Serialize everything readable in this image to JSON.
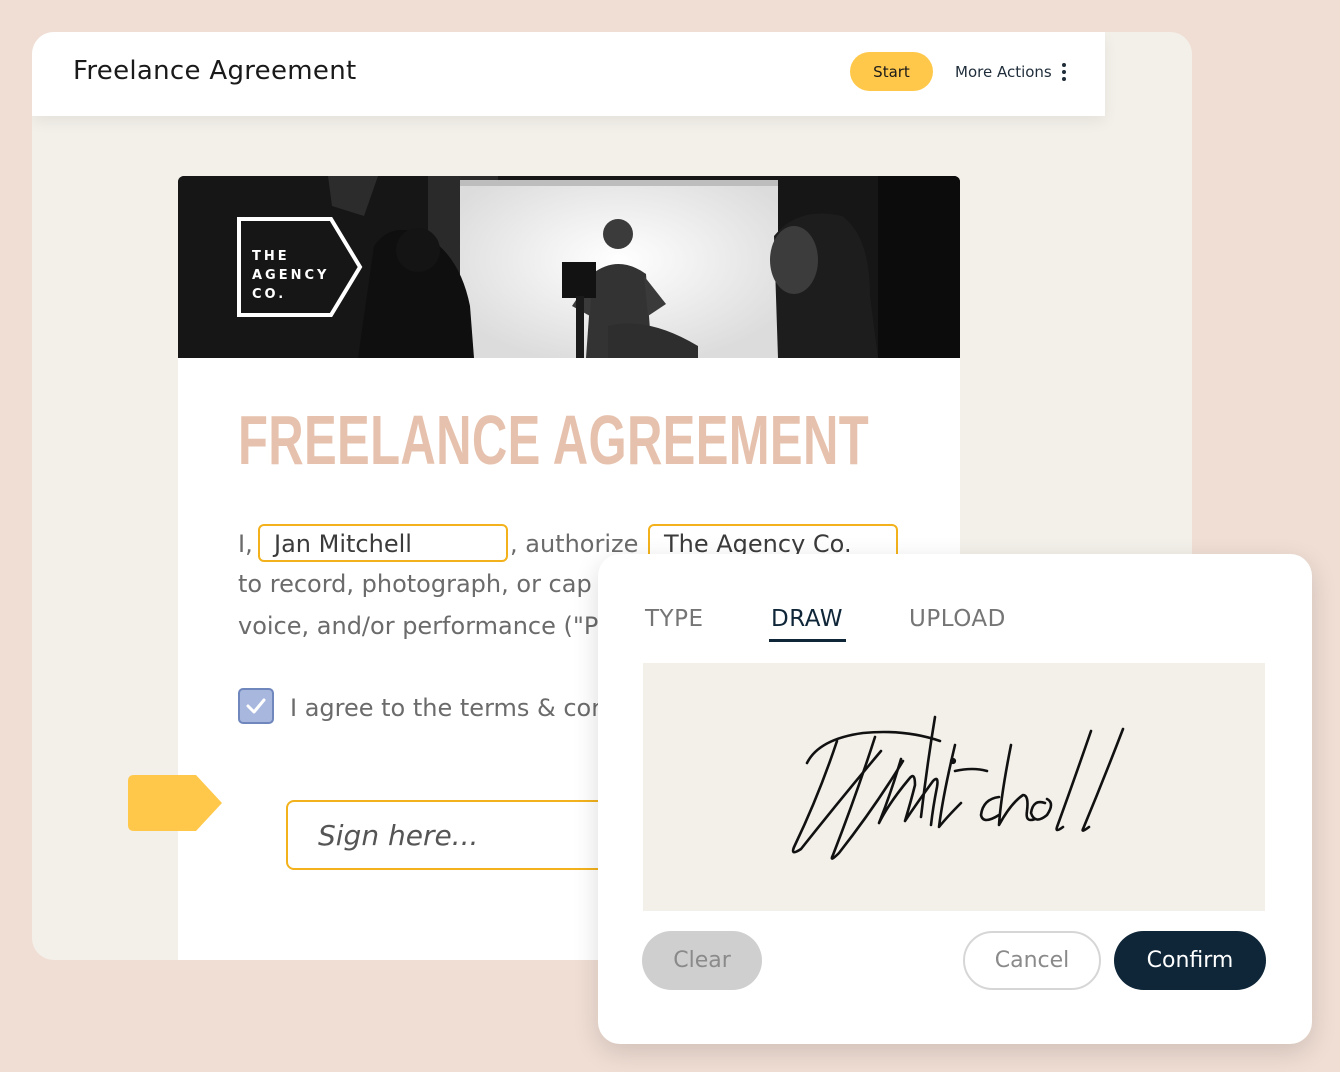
{
  "header": {
    "title": "Freelance Agreement",
    "start_label": "Start",
    "more_actions_label": "More Actions"
  },
  "document": {
    "logo_lines": [
      "THE",
      "AGENCY",
      "CO."
    ],
    "heading": "FREELANCE AGREEMENT",
    "line1_prefix": "I,",
    "signer_name": "Jan Mitchell",
    "line1_middle": ", authorize",
    "company_name": "The Agency Co.",
    "line2": "to record, photograph, or cap",
    "line3": "voice, and/or performance (\"P",
    "agree_label": "I agree to the terms & cor",
    "agree_checked": true,
    "sign_placeholder": "Sign here..."
  },
  "signature_modal": {
    "tabs": [
      {
        "label": "TYPE",
        "active": false
      },
      {
        "label": "DRAW",
        "active": true
      },
      {
        "label": "UPLOAD",
        "active": false
      }
    ],
    "clear_label": "Clear",
    "cancel_label": "Cancel",
    "confirm_label": "Confirm"
  },
  "colors": {
    "accent_yellow": "#ffc84a",
    "field_border": "#f3b21c",
    "heading": "#e6c2ae",
    "navy": "#0e2638",
    "checkbox": "#a7b7de"
  }
}
